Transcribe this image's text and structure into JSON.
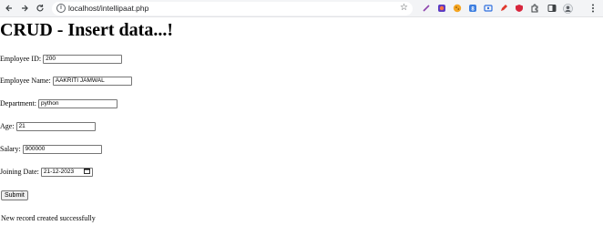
{
  "browser": {
    "url": "localhost/intellipaat.php"
  },
  "page": {
    "title": "CRUD - Insert data...!",
    "form": {
      "fields": [
        {
          "label": "Employee ID:",
          "value": "200"
        },
        {
          "label": "Employee Name:",
          "value": "AAKRITI JAMWAL"
        },
        {
          "label": "Department:",
          "value": "python"
        },
        {
          "label": "Age:",
          "value": "21"
        },
        {
          "label": "Salary:",
          "value": "900000"
        },
        {
          "label": "Joining Date:",
          "value": "21-12-2023"
        }
      ],
      "submit_label": "Submit"
    },
    "status_message": "New record created successfully"
  },
  "colors": {
    "toolbar_bg": "#f3f4f6",
    "omnibox_bg": "#ffffff",
    "text": "#000000",
    "input_border": "#767676"
  }
}
